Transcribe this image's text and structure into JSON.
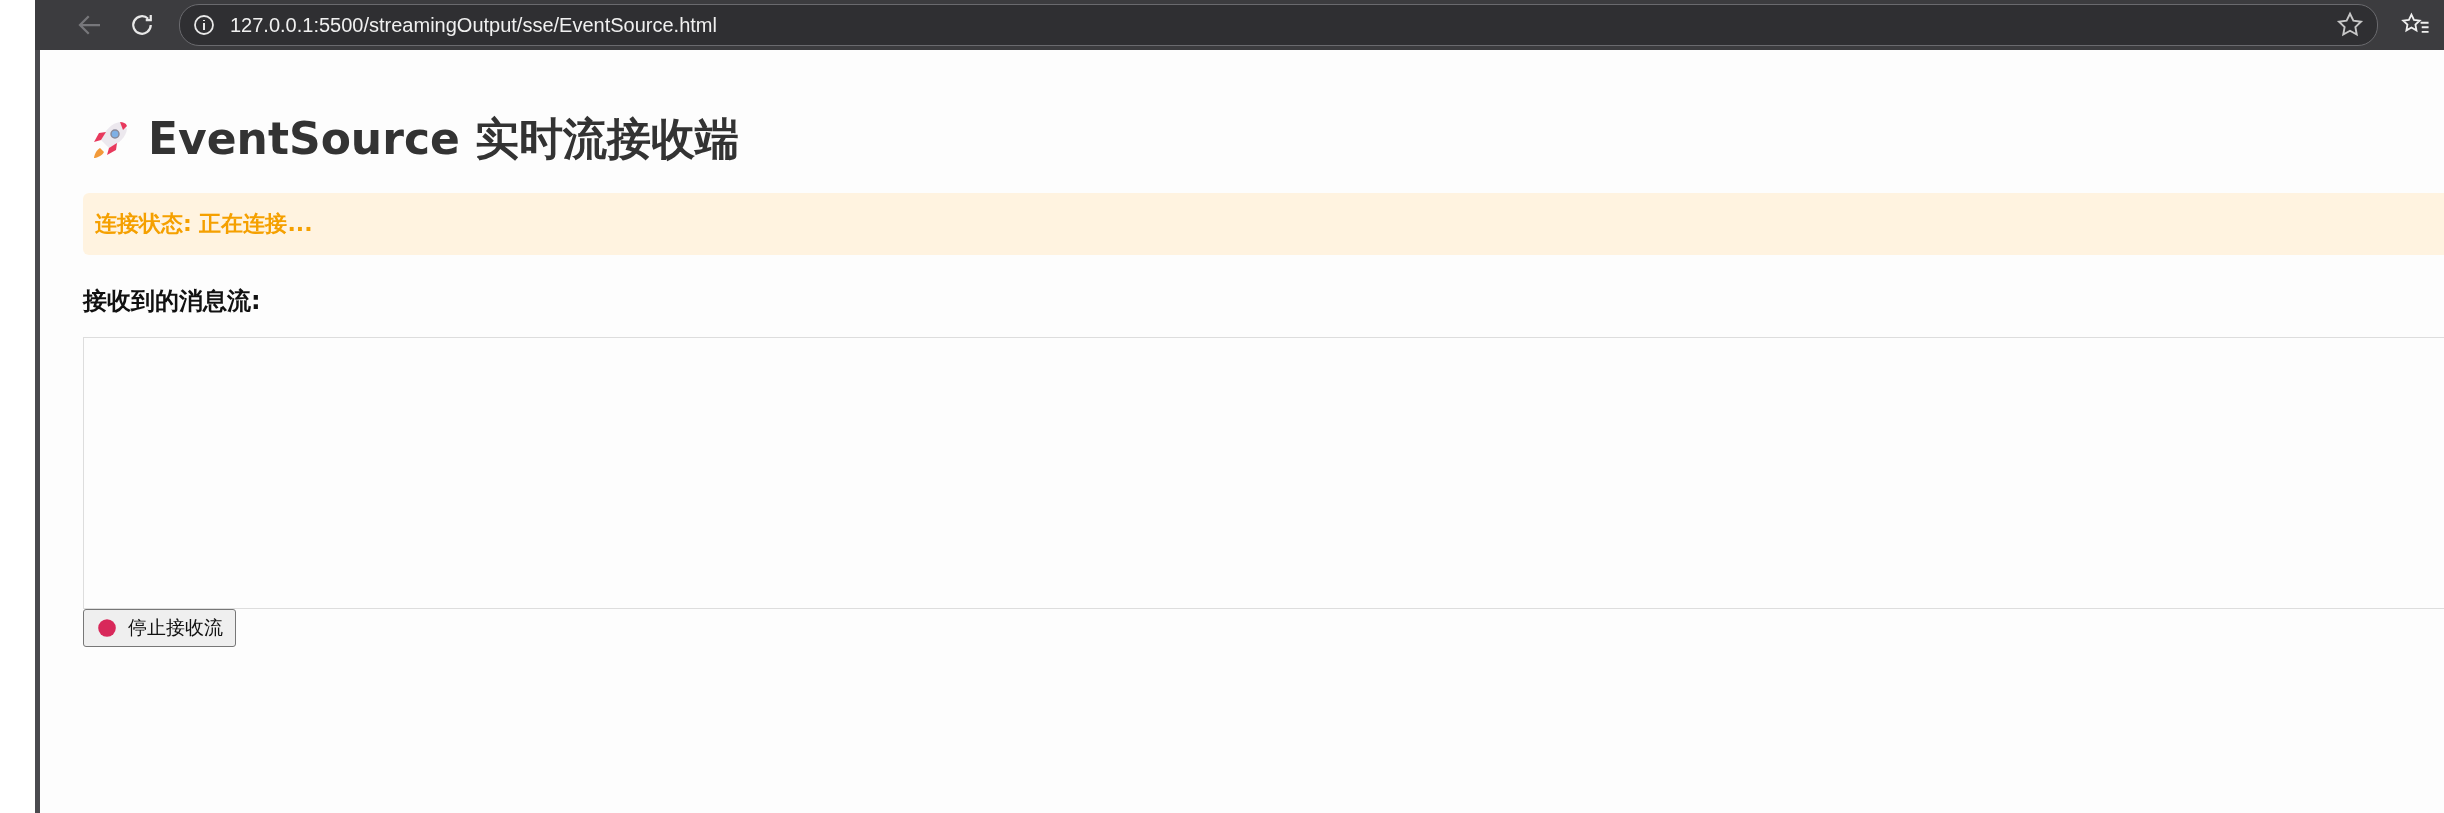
{
  "browser": {
    "url": "127.0.0.1:5500/streamingOutput/sse/EventSource.html"
  },
  "page": {
    "title": "EventSource 实时流接收端",
    "status": "连接状态: 正在连接...",
    "messages_heading": "接收到的消息流:",
    "stop_button": "停止接收流"
  }
}
